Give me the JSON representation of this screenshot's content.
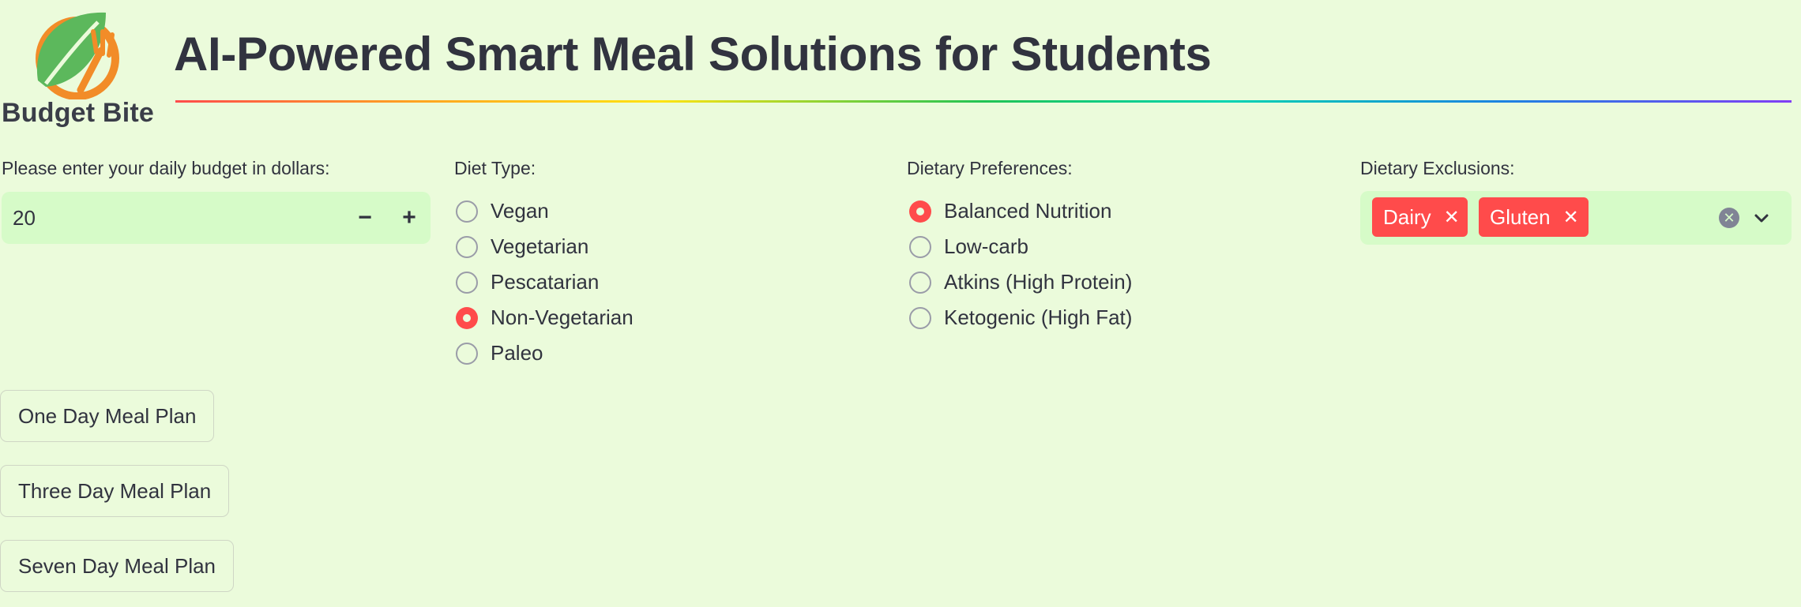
{
  "header": {
    "logo_text": "Budget Bite",
    "title": "AI-Powered Smart Meal Solutions for Students"
  },
  "budget": {
    "label": "Please enter your daily budget in dollars:",
    "value": "20",
    "minus": "−",
    "plus": "+"
  },
  "diet_type": {
    "label": "Diet Type:",
    "options": [
      "Vegan",
      "Vegetarian",
      "Pescatarian",
      "Non-Vegetarian",
      "Paleo"
    ],
    "selected": "Non-Vegetarian"
  },
  "preferences": {
    "label": "Dietary Preferences:",
    "options": [
      "Balanced Nutrition",
      "Low-carb",
      "Atkins (High Protein)",
      "Ketogenic (High Fat)"
    ],
    "selected": "Balanced Nutrition"
  },
  "exclusions": {
    "label": "Dietary Exclusions:",
    "tags": [
      "Dairy",
      "Gluten"
    ],
    "remove_glyph": "✕",
    "clear_glyph": "✕"
  },
  "buttons": {
    "one_day": "One Day Meal Plan",
    "three_day": "Three Day Meal Plan",
    "seven_day": "Seven Day Meal Plan"
  },
  "colors": {
    "background": "#ebfbdb",
    "accent": "#ff4b4b",
    "input_bg": "#d6fbc8",
    "logo_green": "#5cb85c",
    "logo_orange": "#f28c28"
  },
  "icons": {
    "logo": "leaf-fork-logo-icon",
    "clear": "clear-circle-icon",
    "dropdown": "chevron-down-icon"
  }
}
